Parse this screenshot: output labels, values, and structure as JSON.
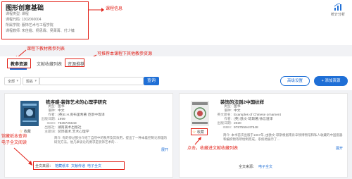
{
  "course": {
    "title": "图形创意基础",
    "lines": [
      "课程类型: 课程",
      "课程代码: 1302060004",
      "所属学院: 服饰艺术与工程学院",
      "课程教师: 宋佳楹、杨思霖、吴菁菁、付少镛"
    ]
  },
  "stats": {
    "label": "统计分析"
  },
  "annotations": {
    "course_info": "课程信息",
    "textbook_list": "课程下教材教参列表",
    "recommend_list": "可推荐本课程下其他教参资源",
    "fulltext_read": "馆藏纸本查询\n电子全文阅读",
    "favorite_hint": "点击，收藏进文献收藏列表"
  },
  "tabs": [
    {
      "label": "教参资源"
    },
    {
      "label": "文献收藏列表"
    },
    {
      "label": "资源推荐"
    }
  ],
  "filters": {
    "scope": "全部",
    "field": "题名",
    "search_placeholder": "",
    "search_button": "查询",
    "advanced_button": "高级设置",
    "add_button": "+ 添加资源"
  },
  "books": [
    {
      "cover_color": "#2b5f8a",
      "cover_text": "精品",
      "title": "铁序感-装饰艺术的心理学研究",
      "meta": [
        {
          "k": "类型:",
          "v": "图书"
        },
        {
          "k": "语种:",
          "v": "中文"
        },
        {
          "k": "作者:",
          "v": "(英)E.H.贡布里希著 范景中等译"
        },
        {
          "k": "出版日期:",
          "v": "1999"
        },
        {
          "k": "ISSN:",
          "v": "7535725643"
        },
        {
          "k": "出版社:",
          "v": "湖南美术出版社"
        },
        {
          "k": "主题词:",
          "v": "装饰美术,艺术心理学"
        }
      ],
      "abstract": "简介: 有的停过部分介绍了自然中的秩序及其效用，提出了一种本着控制论原理的研究方法。他几章谈论的要求是装饰艺术的…",
      "expand": "展开",
      "favorite": "收藏",
      "source_label": "全文来源：",
      "sources": [
        "馆藏纸本",
        "文献传递",
        "电子全文"
      ]
    },
    {
      "cover_color": "#c9c9c9",
      "cover_text": "装饰",
      "title": "装饰的法则2中国纹样",
      "meta": [
        {
          "k": "类型:",
          "v": "图书"
        },
        {
          "k": "语种:",
          "v": "中文"
        },
        {
          "k": "英文题名:",
          "v": "Examples of Chinese ornament"
        },
        {
          "k": "作者:",
          "v": "(英) 欧文·琼斯著;徐信道译"
        },
        {
          "k": "出版日期:",
          "v": "2020"
        },
        {
          "k": "ISBN:",
          "v": "9787559447548"
        }
      ],
      "abstract": "简介: 本书首次出版于1867年, 由欧文·琼斯根据南肯辛顿博物馆和私人收藏的中国瓷器和编织物等所绘制而成，系统地展示了…",
      "expand": "展开",
      "favorite": "收藏",
      "source_label": "全文来源：",
      "sources": [
        "电子全文"
      ]
    }
  ]
}
